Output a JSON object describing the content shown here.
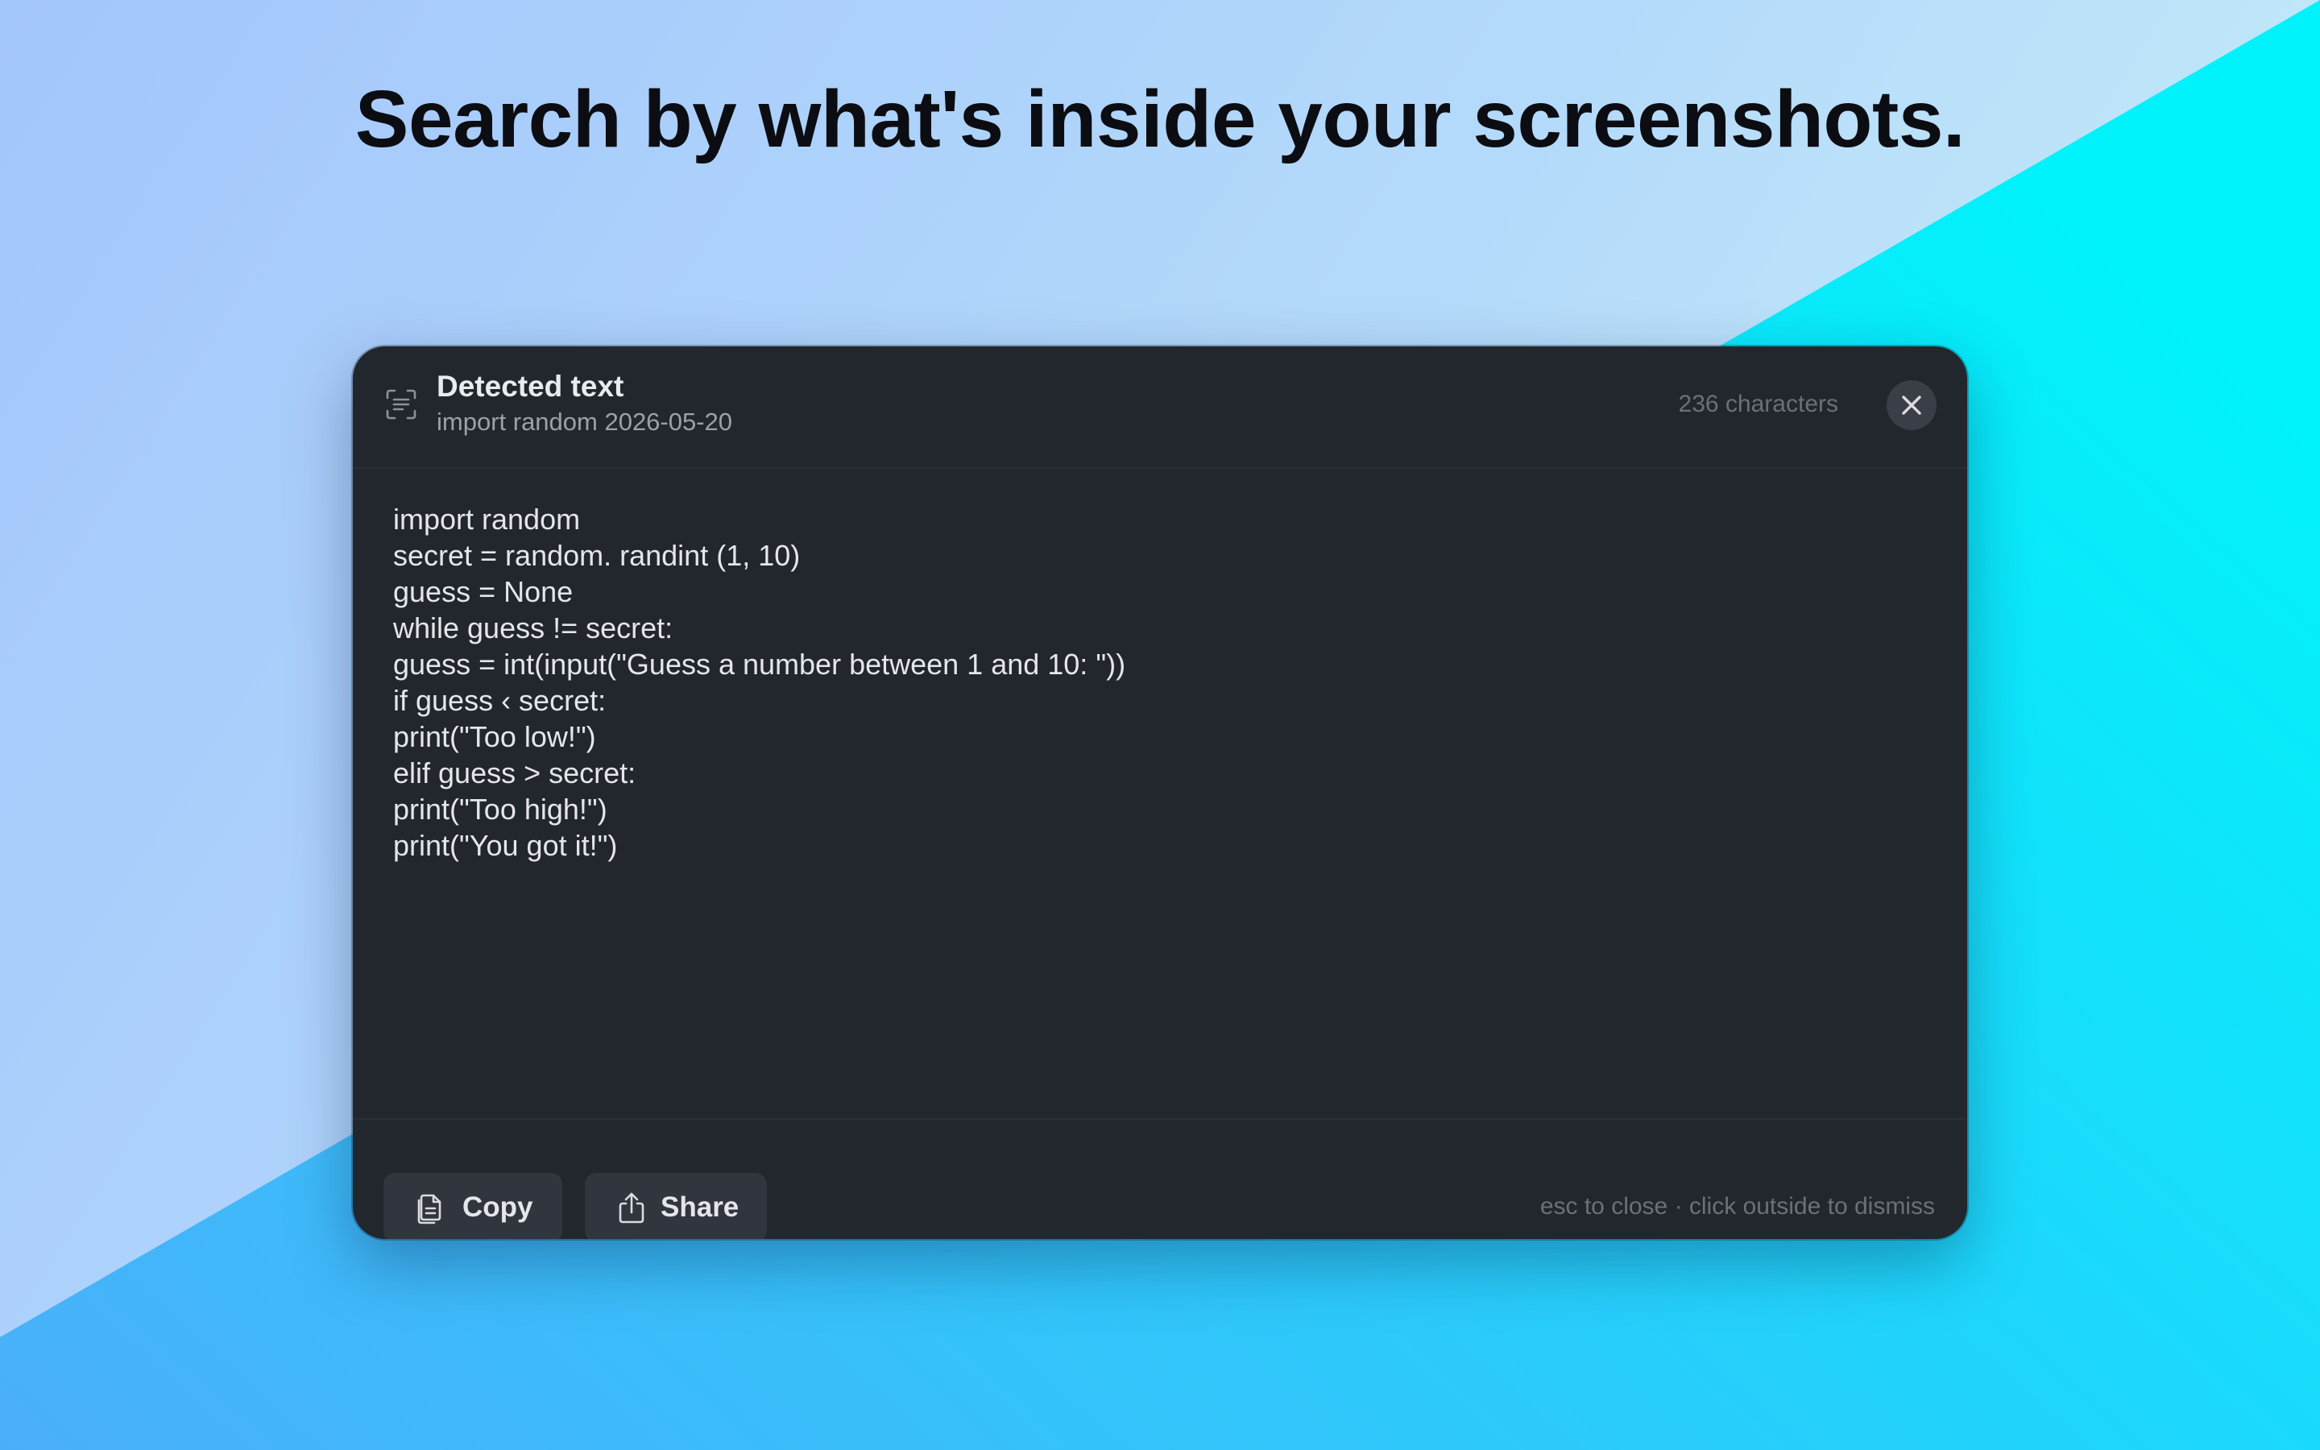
{
  "page": {
    "headline": "Search by what's inside your screenshots."
  },
  "colors": {
    "background_left": "#a3c6fb",
    "background_right": "#05f0fb",
    "panel_background": "#22262d",
    "text_primary": "#e9ebee",
    "text_muted": "#6b7079"
  },
  "dialog": {
    "header": {
      "icon": "text-scan-icon",
      "title": "Detected text",
      "subtitle": "import random 2026-05-20",
      "char_count": "236 characters",
      "close_icon": "close-icon"
    },
    "body": {
      "lines": [
        "import random",
        "secret = random. randint (1, 10)",
        "guess = None",
        "while guess != secret:",
        "guess = int(input(\"Guess a number between 1 and 10: \"))",
        "if guess ‹ secret:",
        "print(\"Too low!\")",
        "elif guess > secret:",
        "print(\"Too high!\")",
        "print(\"You got it!\")"
      ]
    },
    "footer": {
      "copy_button": {
        "icon": "copy-icon",
        "label": "Copy"
      },
      "share_button": {
        "icon": "share-icon",
        "label": "Share"
      },
      "hint": "esc to close · click outside to dismiss"
    }
  }
}
